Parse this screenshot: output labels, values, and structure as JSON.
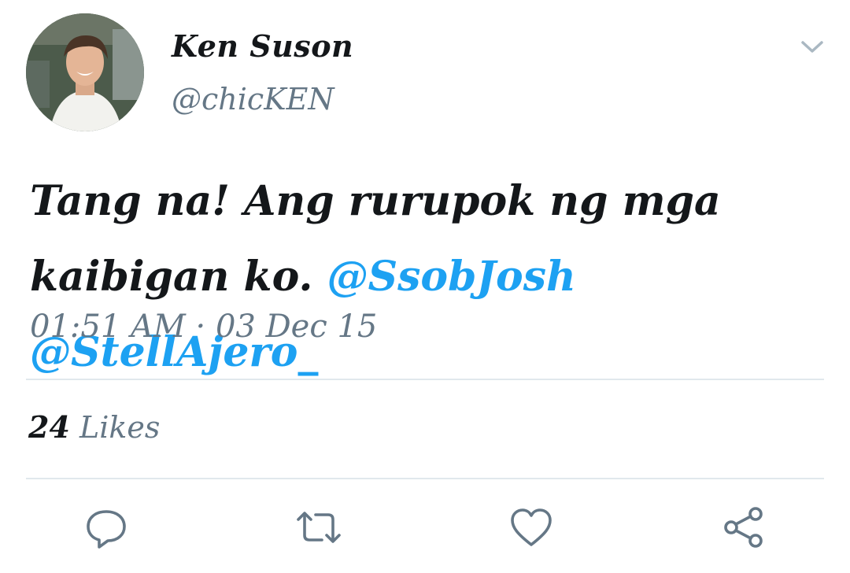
{
  "author": {
    "display_name": "Ken Suson",
    "handle": "@chicKEN"
  },
  "tweet": {
    "text_before": "Tang na! Ang rurupok ng mga kaibigan ko. ",
    "mentions": [
      "@SsobJosh",
      "@StellAjero_"
    ],
    "timestamp": "01:51 AM · 03 Dec 15"
  },
  "stats": {
    "likes_count": "24",
    "likes_label": "Likes"
  },
  "colors": {
    "text": "#14171a",
    "secondary": "#657786",
    "link": "#1da1f2",
    "divider": "#e1e8ed"
  },
  "icons": {
    "menu": "chevron-down-icon",
    "reply": "reply-icon",
    "retweet": "retweet-icon",
    "like": "heart-icon",
    "share": "share-icon"
  }
}
